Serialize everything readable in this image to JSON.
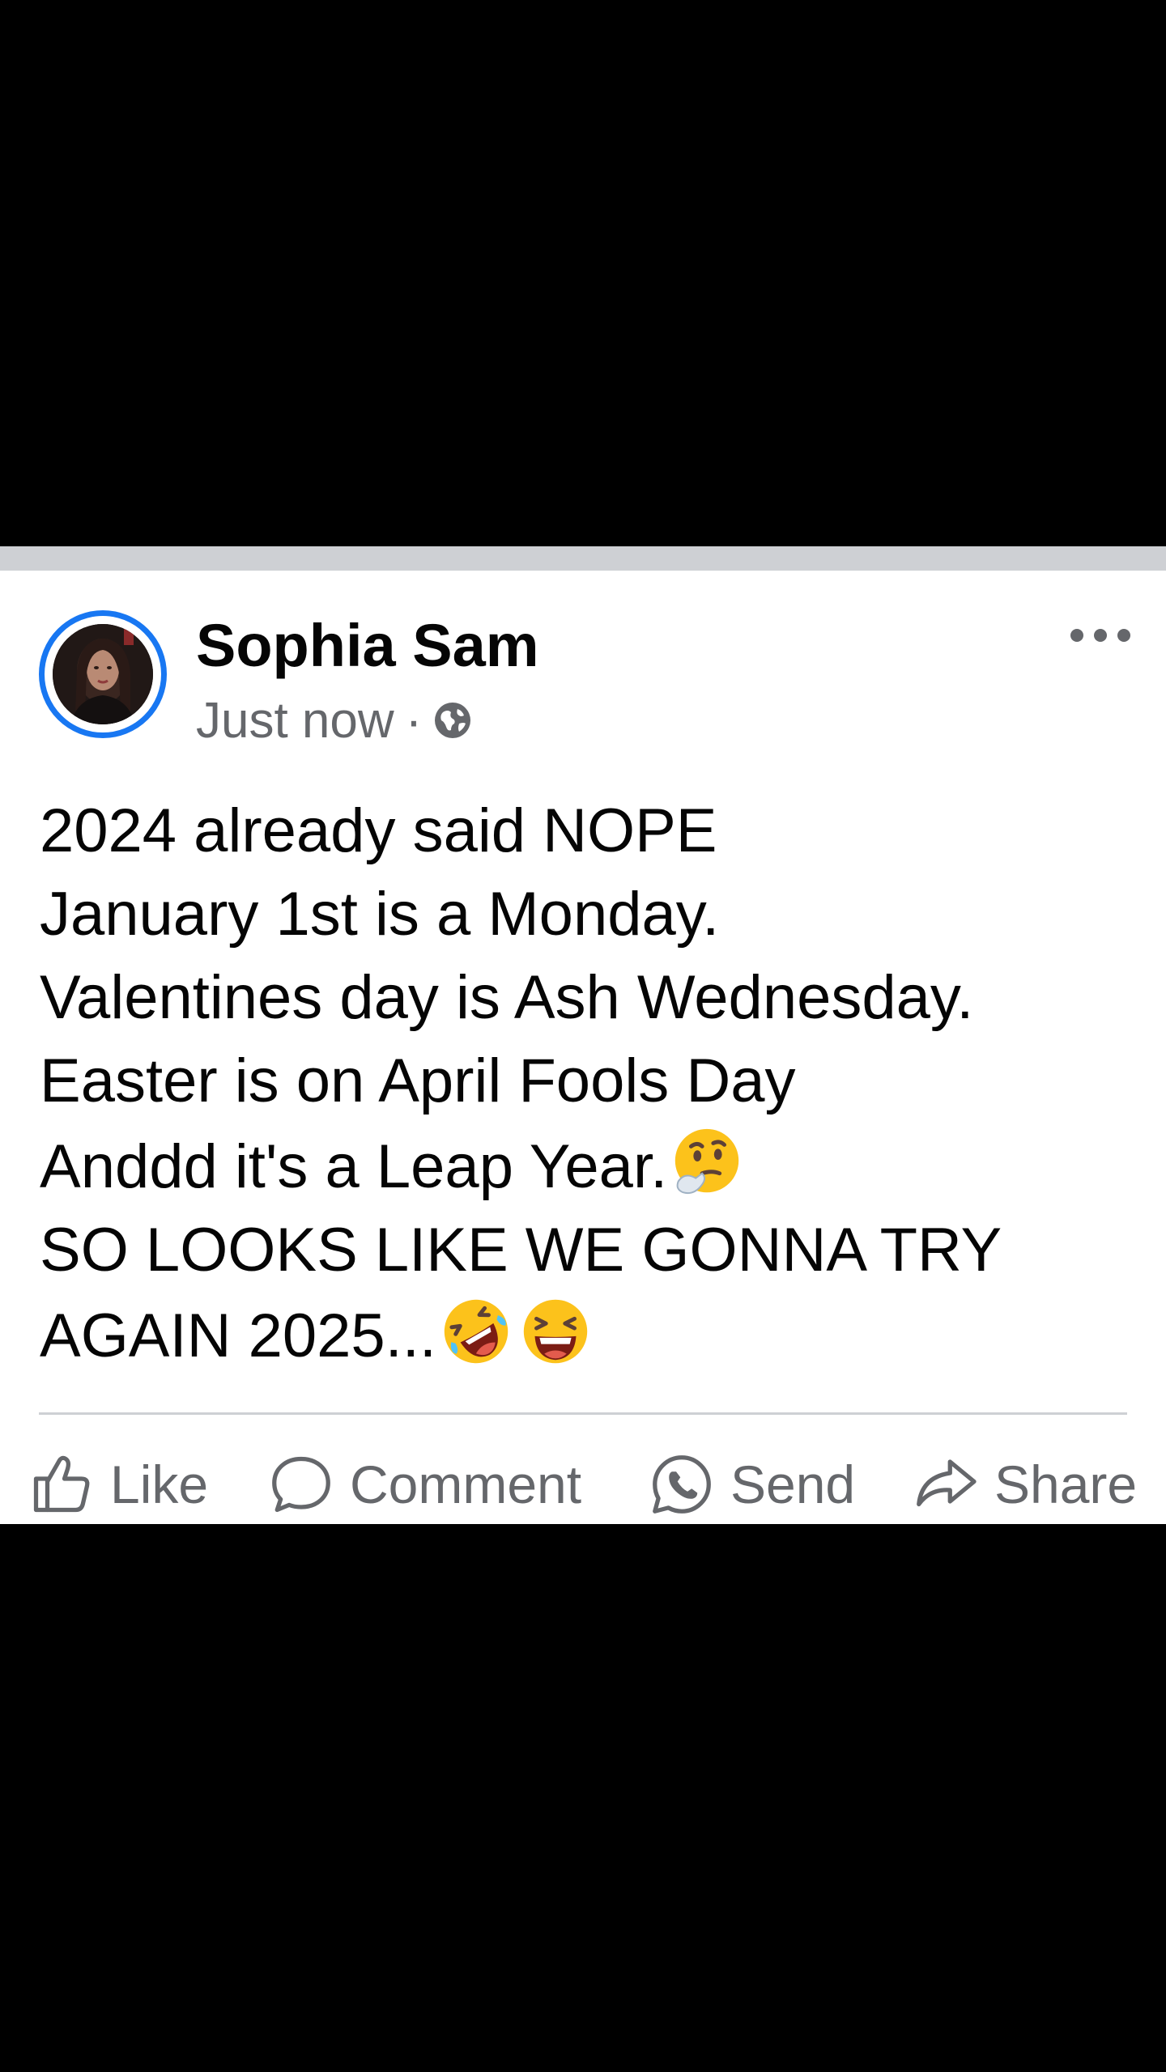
{
  "post": {
    "author": "Sophia Sam",
    "timestamp": "Just now",
    "separator_dot": "·",
    "privacy_icon": "globe-icon",
    "more_icon": "more-horizontal-icon",
    "lines": [
      "2024 already said NOPE",
      "January 1st is a Monday.",
      "Valentines day is Ash Wednesday.",
      "Easter is on April Fools Day",
      "Anddd it's a Leap Year.",
      "SO LOOKS LIKE WE GONNA TRY",
      "AGAIN 2025..."
    ],
    "emojis": [
      "thinking-face-emoji",
      "rolling-on-the-floor-laughing-emoji",
      "grinning-squinting-face-emoji"
    ]
  },
  "actions": {
    "like": "Like",
    "comment": "Comment",
    "send": "Send",
    "share": "Share"
  },
  "colors": {
    "accent": "#1877f2",
    "text_primary": "#050505",
    "text_secondary": "#65676b",
    "divider": "#ced0d4",
    "background": "#000000",
    "card": "#ffffff"
  }
}
